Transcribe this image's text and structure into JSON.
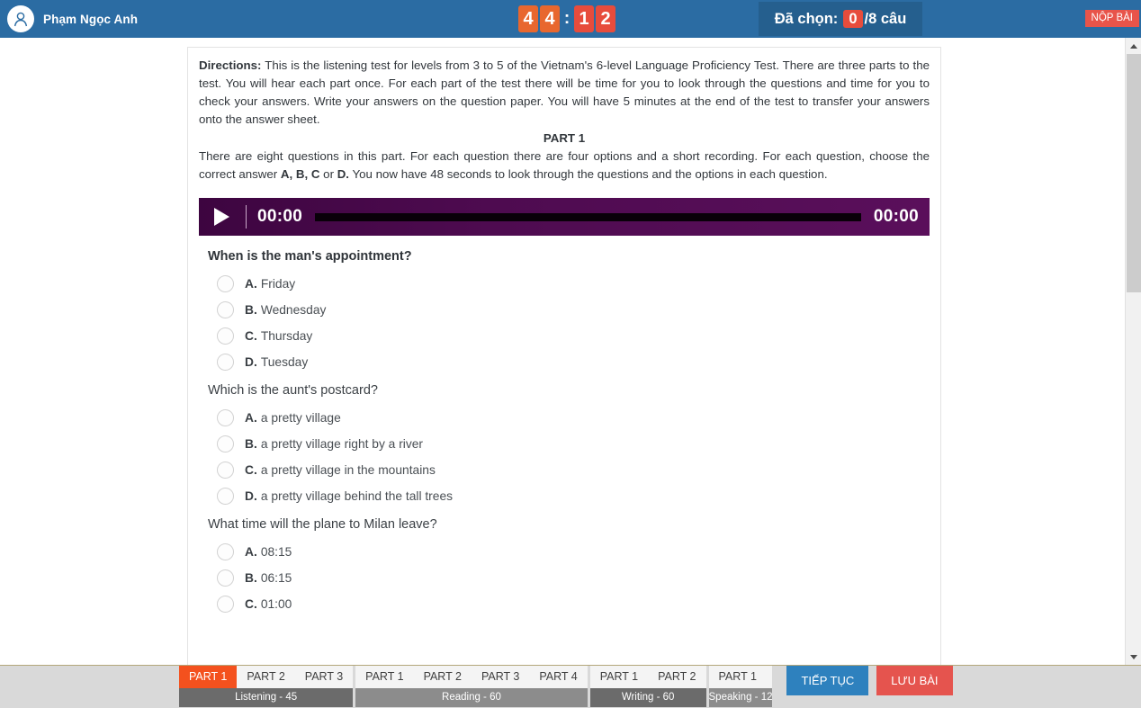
{
  "header": {
    "user_name": "Phạm Ngọc Anh",
    "avatar_icon": "user-avatar-icon",
    "timer": {
      "digits": [
        "4",
        "4",
        "1",
        "2"
      ],
      "separator": ":",
      "minutes": "44",
      "seconds": "12",
      "colors": {
        "minutes_bg": "#e8672e",
        "seconds_bg": "#e74c3c"
      }
    },
    "chosen": {
      "label": "Đã chọn:",
      "count": "0",
      "total": "/8 câu"
    },
    "submit_label": "NỘP BÀI",
    "bg_color": "#2b6ca3"
  },
  "content": {
    "directions_label": "Directions:",
    "directions_text": " This is the listening test for levels from 3 to 5 of the Vietnam's 6-level Language Proficiency Test. There are three parts to the test. You will hear each part once. For each part of the test there will be time for you to look through the questions and time for you to check your answers. Write your answers on the question paper. You will have 5 minutes at the end of the test to transfer your answers onto the answer sheet.",
    "part_heading": "PART 1",
    "part_desc_1": "There are eight questions in this part. For each question there are four options and a short recording. For each question, choose the correct answer ",
    "part_desc_bold": "A, B, C",
    "part_desc_2": " or ",
    "part_desc_bold2": "D.",
    "part_desc_3": " You now have 48 seconds to look through the questions and the options in each question."
  },
  "player": {
    "play_icon": "play-icon",
    "current_time": "00:00",
    "duration": "00:00",
    "progress_percent": 0,
    "bg_color": "#4b0a4b"
  },
  "questions": [
    {
      "title": "When is the man's appointment?",
      "bold": true,
      "options": [
        {
          "letter": "A.",
          "text": "Friday"
        },
        {
          "letter": "B.",
          "text": "Wednesday"
        },
        {
          "letter": "C.",
          "text": "Thursday"
        },
        {
          "letter": "D.",
          "text": "Tuesday"
        }
      ]
    },
    {
      "title": "Which is the aunt's postcard?",
      "bold": false,
      "options": [
        {
          "letter": "A.",
          "text": "a pretty village"
        },
        {
          "letter": "B.",
          "text": "a pretty village right by a river"
        },
        {
          "letter": "C.",
          "text": "a pretty village in the mountains"
        },
        {
          "letter": "D.",
          "text": "a pretty village behind the tall trees"
        }
      ]
    },
    {
      "title": "What time will the plane to Milan leave?",
      "bold": false,
      "options": [
        {
          "letter": "A.",
          "text": "08:15"
        },
        {
          "letter": "B.",
          "text": "06:15"
        },
        {
          "letter": "C.",
          "text": "01:00"
        }
      ]
    }
  ],
  "scrollbar": {
    "up_icon": "chevron-up-icon",
    "down_icon": "chevron-down-icon"
  },
  "bottombar": {
    "skills": [
      {
        "label": "Listening - 45",
        "label_shade": "dark",
        "tabs": [
          {
            "name": "PART 1",
            "active": true
          },
          {
            "name": "PART 2",
            "active": false
          },
          {
            "name": "PART 3",
            "active": false
          }
        ]
      },
      {
        "label": "Reading - 60",
        "label_shade": "light",
        "tabs": [
          {
            "name": "PART 1",
            "active": false
          },
          {
            "name": "PART 2",
            "active": false
          },
          {
            "name": "PART 3",
            "active": false
          },
          {
            "name": "PART 4",
            "active": false
          }
        ]
      },
      {
        "label": "Writing - 60",
        "label_shade": "dark",
        "tabs": [
          {
            "name": "PART 1",
            "active": false
          },
          {
            "name": "PART 2",
            "active": false
          }
        ]
      },
      {
        "label": "Speaking - 12",
        "label_shade": "light",
        "tabs": [
          {
            "name": "PART 1",
            "active": false
          }
        ]
      }
    ],
    "continue_label": "TIẾP TỤC",
    "save_label": "LƯU BÀI"
  }
}
